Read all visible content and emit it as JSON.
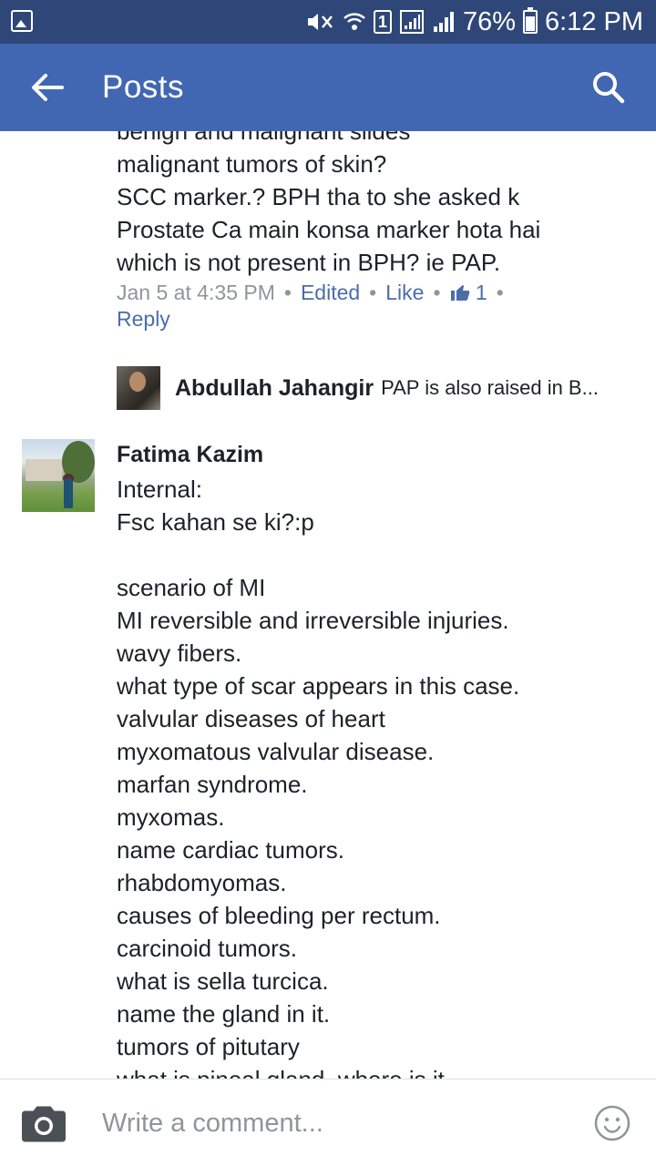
{
  "status_bar": {
    "battery_percent": "76%",
    "time": "6:12 PM",
    "sim_slot": "1"
  },
  "app_bar": {
    "title": "Posts"
  },
  "comment_1": {
    "lines": [
      "benign and malignant slides",
      "malignant tumors of skin?",
      "SCC marker.? BPH tha to she asked k",
      "Prostate Ca main konsa marker hota hai",
      "which is not present in BPH? ie PAP."
    ],
    "timestamp": "Jan 5 at 4:35 PM",
    "edited_label": "Edited",
    "like_label": "Like",
    "like_count": "1",
    "reply_label": "Reply",
    "reply_preview": {
      "author": "Abdullah Jahangir",
      "text": "PAP is also raised in B..."
    }
  },
  "comment_2": {
    "author": "Fatima Kazim",
    "lines": [
      "Internal:",
      "Fsc kahan se ki?:p",
      "",
      "scenario of MI",
      "MI reversible and irreversible injuries.",
      "wavy fibers.",
      "what type of scar appears in this case.",
      "valvular diseases of heart",
      "myxomatous valvular disease.",
      "marfan syndrome.",
      "myxomas.",
      "name cardiac tumors.",
      "rhabdomyomas.",
      "causes of bleeding per rectum.",
      "carcinoid tumors.",
      "what is sella turcica.",
      "name the gland in it.",
      "tumors of pitutary",
      "what is pineal gland. where is it."
    ]
  },
  "composer": {
    "placeholder": "Write a comment..."
  },
  "colors": {
    "status_bar_bg": "#2f4778",
    "app_bar_bg": "#4267b2",
    "link_blue": "#4b6ea8",
    "meta_gray": "#90949c"
  }
}
